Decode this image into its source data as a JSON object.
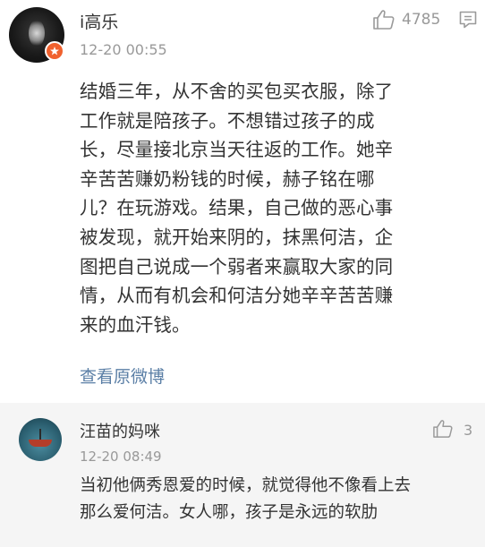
{
  "main_comment": {
    "username": "i高乐",
    "timestamp": "12-20 00:55",
    "like_count": "4785",
    "body_lines": [
      "结婚三年，从不舍的买包买衣服，除了",
      "工作就是陪孩子。不想错过孩子的成",
      "长，尽量接北京当天往返的工作。她辛",
      "辛苦苦赚奶粉钱的时候，赫子铭在哪",
      "儿？在玩游戏。结果，自己做的恶心事",
      "被发现，就开始来阴的，抹黑何洁，企",
      "图把自己说成一个弱者来赢取大家的同",
      "情，从而有机会和何洁分她辛辛苦苦赚",
      "来的血汗钱。"
    ],
    "view_original_label": "查看原微博",
    "icons": {
      "like": "thumbs-up-icon",
      "reply": "comment-icon",
      "badge": "verified-badge-icon"
    }
  },
  "sub_comment": {
    "username": "汪苗的妈咪",
    "timestamp": "12-20 08:49",
    "like_count": "3",
    "body_lines": [
      "当初他俩秀恩爱的时候，就觉得他不像看上去",
      "那么爱何洁。女人哪，孩子是永远的软肋"
    ]
  },
  "colors": {
    "link": "#5b7fa6",
    "badge": "#f0612e",
    "muted": "#999999",
    "sub_bg": "#f5f5f5"
  }
}
